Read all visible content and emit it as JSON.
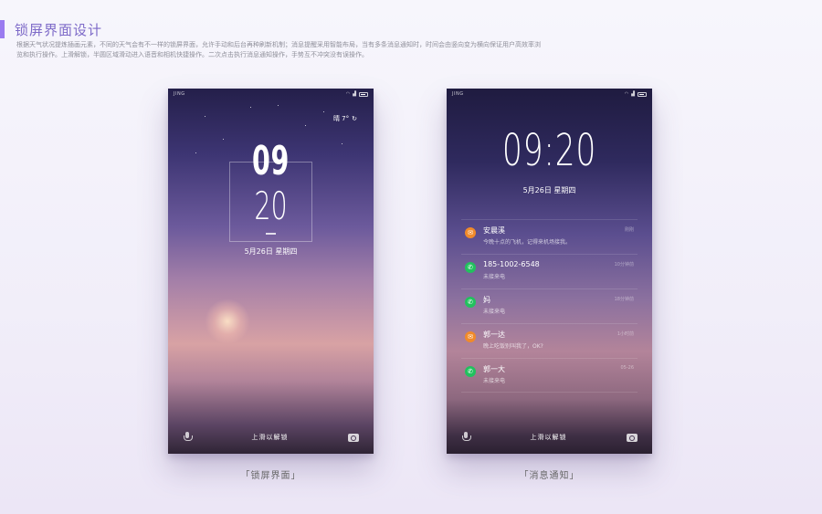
{
  "header": {
    "title": "锁屏界面设计",
    "description": "根据天气状况提炼插画元素，不同的天气会有不一样的锁屏界面，允许手动和后台再种刷新机制；消息提醒采用智能布局，当有多条消息通知时，时间会由竖向变为横向保证用户高效率浏览和执行操作。上滑解锁，半圆区域滑动进入语音和相机快捷操作。二次点击执行消息通知操作，手势互不冲突没有误操作。",
    "accent_color": "#9a7bf0"
  },
  "lock_screen": {
    "carrier": "JING",
    "weather": "晴 7°",
    "hour": "09",
    "minute": "20",
    "date": "5月26日  星期四",
    "unlock_label": "上滑以解锁",
    "caption": "「锁屏界面」"
  },
  "notify_screen": {
    "carrier": "JING",
    "time": "09:20",
    "date": "5月26日  星期四",
    "unlock_label": "上滑以解锁",
    "caption": "「消息通知」",
    "notifications": [
      {
        "type": "msg",
        "title": "安晨溪",
        "subtitle": "今晚十点的飞机，记得来机场接我。",
        "time": "刚刚"
      },
      {
        "type": "call",
        "title": "185-1002-6548",
        "subtitle": "未接来电",
        "time": "10分钟前"
      },
      {
        "type": "call",
        "title": "妈",
        "subtitle": "未接来电",
        "time": "18分钟前"
      },
      {
        "type": "msg",
        "title": "郭一达",
        "subtitle": "晚上吃饭别叫我了，OK?",
        "time": "1小时前"
      },
      {
        "type": "call",
        "title": "郭一大",
        "subtitle": "未接来电",
        "time": "05-26"
      }
    ]
  }
}
